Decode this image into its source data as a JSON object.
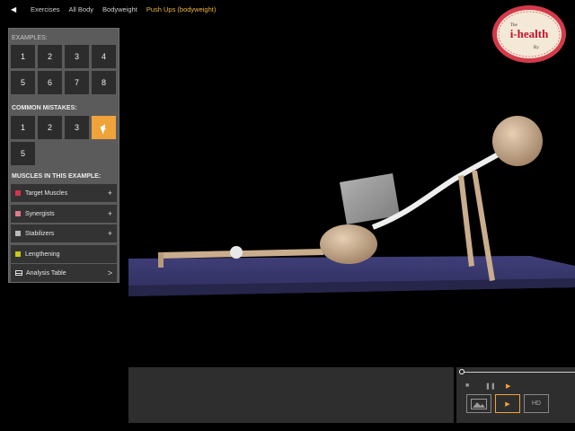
{
  "nav": {
    "back_icon": "back-arrow-icon",
    "crumbs": [
      "Exercises",
      "All Body",
      "Bodyweight",
      "Push Ups (bodyweight)"
    ]
  },
  "panel": {
    "examples_label": "EXAMPLES:",
    "examples": [
      "1",
      "2",
      "3",
      "4",
      "5",
      "6",
      "7",
      "8"
    ],
    "mistakes_label": "COMMON MISTAKES:",
    "mistakes": [
      "1",
      "2",
      "3",
      "4",
      "5"
    ],
    "selected_mistake": "4",
    "muscles_label": "MUSCLES IN THIS EXAMPLE:",
    "muscles": [
      {
        "label": "Target Muscles",
        "color": "#d8334a",
        "action": "+"
      },
      {
        "label": "Synergists",
        "color": "#e07a86",
        "action": "+"
      },
      {
        "label": "Stabilizers",
        "color": "#b9b9b9",
        "action": "+"
      },
      {
        "label": "Lengthening",
        "color": "#c8c81a",
        "action": ""
      },
      {
        "label": "Analysis Table",
        "icon": "table-icon",
        "action": ">"
      }
    ]
  },
  "logo": {
    "top": "The",
    "main": "i-health",
    "bottom": "By"
  },
  "player": {
    "progress": 0.0,
    "controls": [
      "stop-icon",
      "pause-icon",
      "play-icon"
    ],
    "buttons": [
      "image-icon",
      "play-icon",
      "HD"
    ],
    "hd_label": "HD"
  },
  "colors": {
    "accent": "#f0a33a",
    "panel": "#5b5b5b",
    "button": "#2c2c2c",
    "mat": "#3b3a6e"
  }
}
